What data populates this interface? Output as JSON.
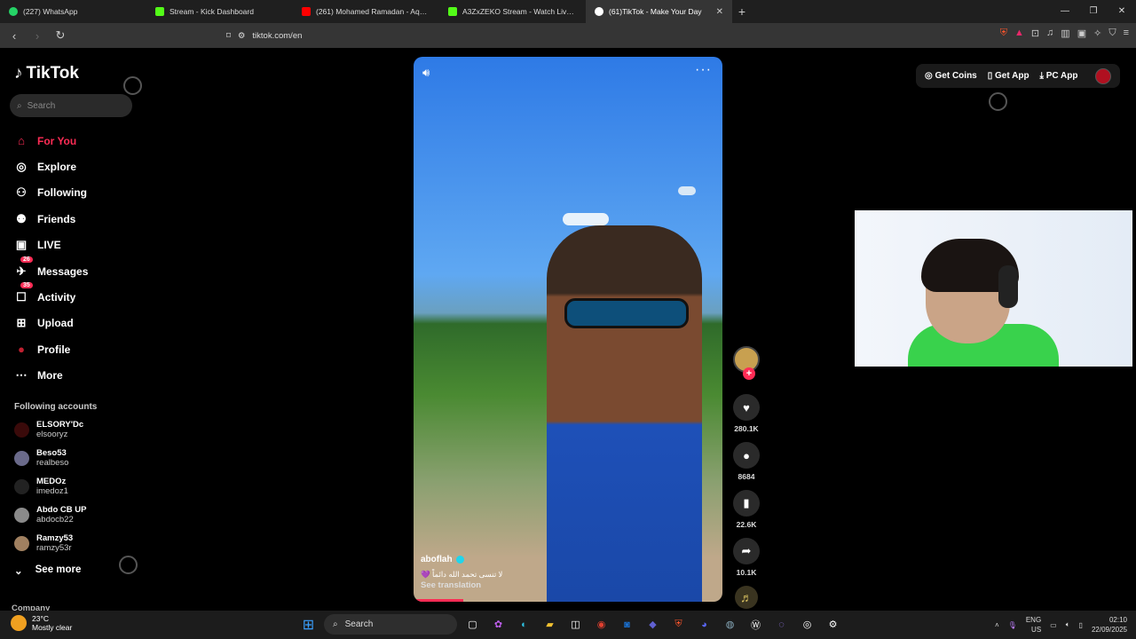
{
  "browser": {
    "tabs": [
      {
        "label": "(227) WhatsApp",
        "color": "#25d366"
      },
      {
        "label": "Stream - Kick Dashboard",
        "color": "#53fc18"
      },
      {
        "label": "(261) Mohamed Ramadan - Aqwa Ka",
        "color": "#ff0000"
      },
      {
        "label": "A3ZxZEKO Stream - Watch Live on K",
        "color": "#53fc18"
      },
      {
        "label": "(61)TikTok - Make Your Day",
        "color": "#ffffff"
      }
    ],
    "url": "tiktok.com/en"
  },
  "sidebar": {
    "logo": "TikTok",
    "search_placeholder": "Search",
    "items": [
      {
        "label": "For You",
        "icon": "home-icon"
      },
      {
        "label": "Explore",
        "icon": "compass-icon"
      },
      {
        "label": "Following",
        "icon": "following-icon"
      },
      {
        "label": "Friends",
        "icon": "friends-icon"
      },
      {
        "label": "LIVE",
        "icon": "live-icon"
      },
      {
        "label": "Messages",
        "icon": "messages-icon",
        "badge": "26"
      },
      {
        "label": "Activity",
        "icon": "activity-icon",
        "badge": "35"
      },
      {
        "label": "Upload",
        "icon": "upload-icon"
      },
      {
        "label": "Profile",
        "icon": "profile-icon"
      },
      {
        "label": "More",
        "icon": "more-icon"
      }
    ],
    "following_heading": "Following accounts",
    "accounts": [
      {
        "name": "ELSORY'Dc",
        "handle": "elsooryz"
      },
      {
        "name": "Beso53",
        "handle": "realbeso"
      },
      {
        "name": "MEDOz",
        "handle": "imedoz1"
      },
      {
        "name": "Abdo CB UP",
        "handle": "abdocb22"
      },
      {
        "name": "Ramzy53",
        "handle": "ramzy53r"
      }
    ],
    "see_more": "See more",
    "company": "Company"
  },
  "video": {
    "author": "aboflah",
    "caption": "لا تنسى تحمد الله دائماً 💜",
    "see_translation": "See translation",
    "progress": 0.16
  },
  "actions": {
    "likes": "280.1K",
    "comments": "8684",
    "saves": "22.6K",
    "shares": "10.1K"
  },
  "top_right": {
    "get_coins": "Get Coins",
    "get_app": "Get App",
    "pc_app": "PC App"
  },
  "taskbar": {
    "temp": "23°C",
    "weather": "Mostly clear",
    "search": "Search",
    "lang1": "ENG",
    "lang2": "US",
    "time": "02:10",
    "date": "22/09/2025"
  }
}
